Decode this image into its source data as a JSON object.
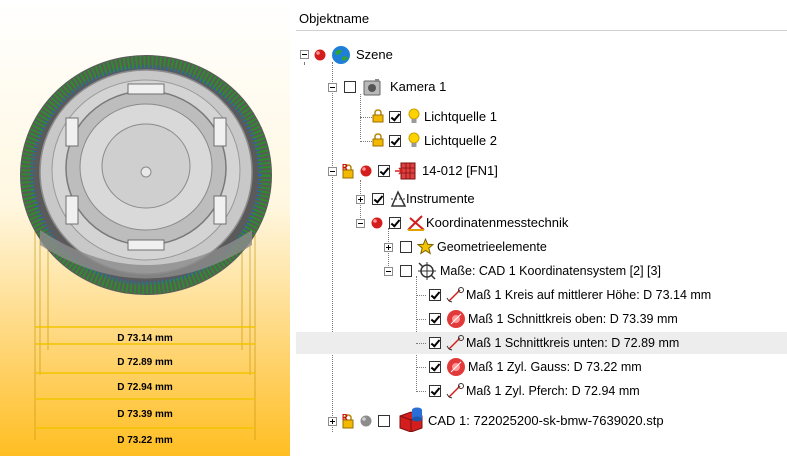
{
  "viewport": {
    "dimension_labels": [
      "D 73.14 mm",
      "D 72.89 mm",
      "D 72.94 mm",
      "D 73.39 mm",
      "D 73.22 mm"
    ]
  },
  "tree": {
    "header": "Objektname",
    "nodes": {
      "szene": "Szene",
      "kamera": "Kamera 1",
      "licht1": "Lichtquelle 1",
      "licht2": "Lichtquelle 2",
      "part": "14-012 [FN1]",
      "instrumente": "Instrumente",
      "kmt": "Koordinatenmesstechnik",
      "geo": "Geometrieelemente",
      "masse": "Maße: CAD 1 Koordinatensystem [2] [3]",
      "m1": "Maß 1 Kreis auf mittlerer Höhe: D 73.14 mm",
      "m2": "Maß 1 Schnittkreis oben: D 73.39 mm",
      "m3": "Maß 1 Schnittkreis unten: D 72.89 mm",
      "m4": "Maß 1 Zyl. Gauss: D 73.22 mm",
      "m5": "Maß 1 Zyl. Pferch: D 72.94 mm",
      "cad": "CAD 1: 722025200-sk-bmw-7639020.stp"
    },
    "icons": [
      "red-ball-icon",
      "globe-icon",
      "camera-icon",
      "lock-icon",
      "bulb-icon",
      "cube-icon",
      "instruments-icon",
      "cmm-icon",
      "star-icon",
      "measure-icon",
      "caliper-icon",
      "red-circle-measure-icon",
      "gray-ball-icon",
      "cad-icon"
    ]
  },
  "colors": {
    "accent_gold": "#ffbe22",
    "dimension_yellow": "#f2c400",
    "selected_row": "#ededed"
  }
}
